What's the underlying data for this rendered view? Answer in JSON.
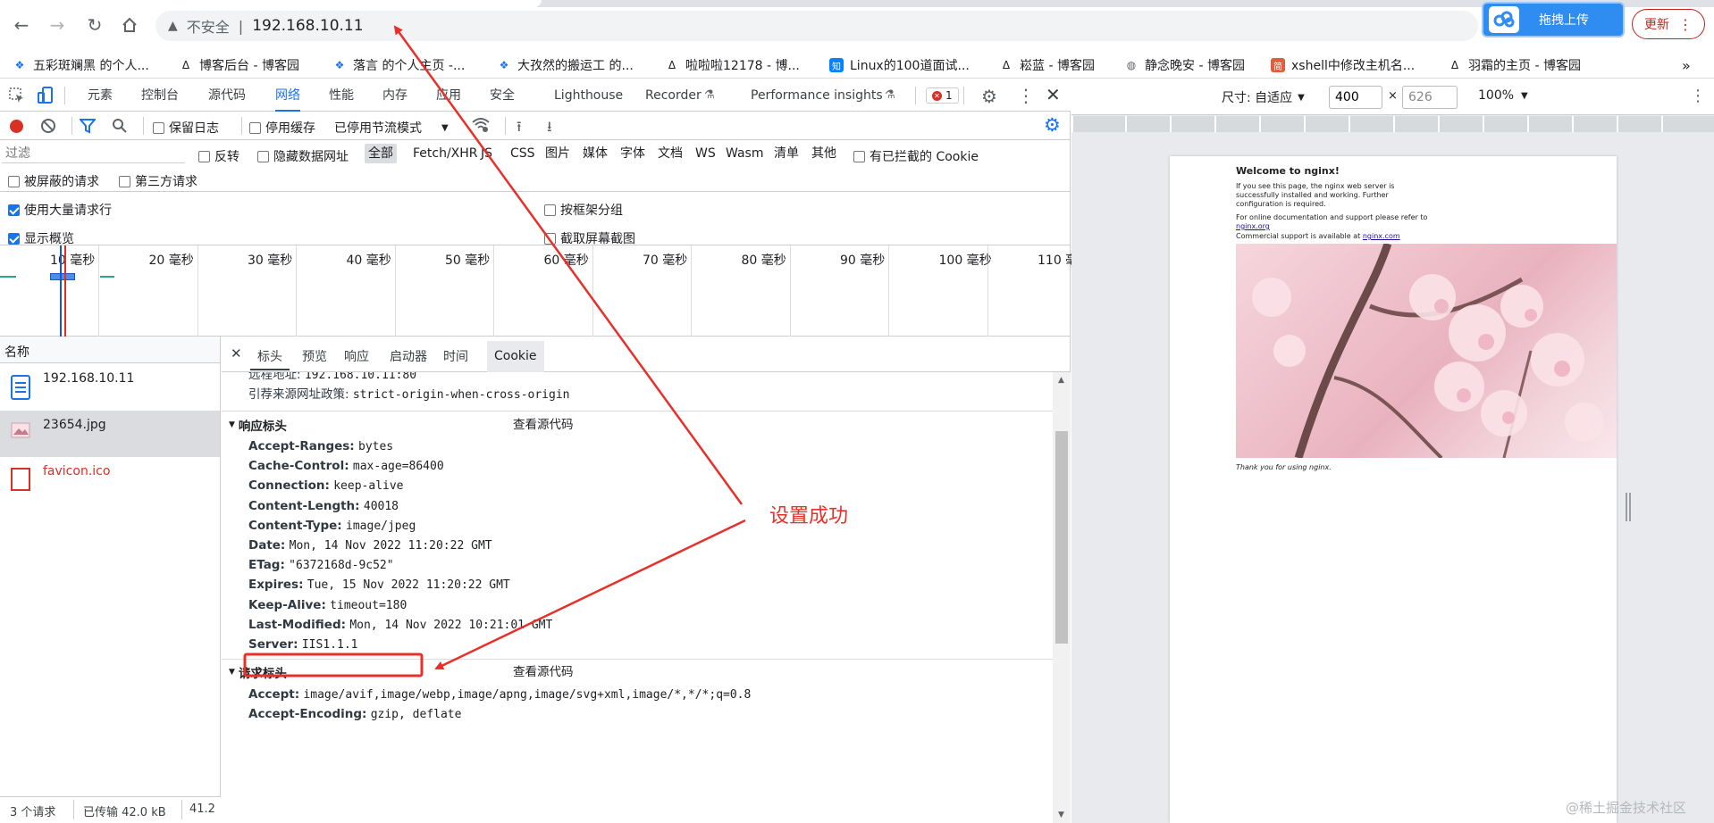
{
  "browser": {
    "address": {
      "security_label": "不安全",
      "url": "192.168.10.11"
    },
    "extension": {
      "upload_label": "拖拽上传"
    },
    "update_label": "更新"
  },
  "bookmarks": [
    {
      "label": "五彩斑斓黑 的个人...",
      "icon": "bookmark-icon"
    },
    {
      "label": "博客后台 - 博客园",
      "icon": "cnblogs-icon"
    },
    {
      "label": "落言 的个人主页 -...",
      "icon": "bookmark-icon"
    },
    {
      "label": "大孜然的搬运工 的...",
      "icon": "bookmark-icon"
    },
    {
      "label": "啦啦啦12178 - 博...",
      "icon": "cnblogs-icon"
    },
    {
      "label": "Linux的100道面试...",
      "icon": "zhihu-icon"
    },
    {
      "label": "崧蓝 - 博客园",
      "icon": "cnblogs-icon"
    },
    {
      "label": "静念晚安 - 博客园",
      "icon": "globe-icon"
    },
    {
      "label": "xshell中修改主机名...",
      "icon": "jian-icon"
    },
    {
      "label": "羽霜的主页 - 博客园",
      "icon": "cnblogs-icon"
    }
  ],
  "bookmarks_more": "»",
  "devtools": {
    "tabs": [
      "元素",
      "控制台",
      "源代码",
      "网络",
      "性能",
      "内存",
      "应用",
      "安全",
      "Lighthouse",
      "Recorder",
      "Performance insights"
    ],
    "selected_tab": "网络",
    "error_count": "1",
    "toolbar": {
      "preserve_log": "保留日志",
      "disable_cache": "停用缓存",
      "throttle": "已停用节流模式"
    },
    "filter": {
      "placeholder": "过滤",
      "invert": "反转",
      "hide_data_urls": "隐藏数据网址",
      "types": [
        "全部",
        "Fetch/XHR",
        "JS",
        "CSS",
        "图片",
        "媒体",
        "字体",
        "文档",
        "WS",
        "Wasm",
        "清单",
        "其他"
      ],
      "blocked_cookies": "有已拦截的 Cookie",
      "blocked_requests": "被屏蔽的请求",
      "third_party": "第三方请求"
    },
    "options": {
      "big_rows": "使用大量请求行",
      "group_by_frame": "按框架分组",
      "show_overview": "显示概览",
      "capture_screenshots": "截取屏幕截图"
    },
    "timeline_ticks": [
      "10 毫秒",
      "20 毫秒",
      "30 毫秒",
      "40 毫秒",
      "50 毫秒",
      "60 毫秒",
      "70 毫秒",
      "80 毫秒",
      "90 毫秒",
      "100 毫秒",
      "110 毫秒"
    ],
    "requests_header": "名称",
    "requests": [
      {
        "name": "192.168.10.11",
        "icon": "document-icon"
      },
      {
        "name": "23654.jpg",
        "icon": "image-icon"
      },
      {
        "name": "favicon.ico",
        "icon": "error-file-icon"
      }
    ],
    "status": {
      "requests": "3 个请求",
      "transferred": "已传输 42.0 kB",
      "size": "41.2"
    },
    "detail_tabs": [
      "标头",
      "预览",
      "响应",
      "启动器",
      "时间",
      "Cookie"
    ],
    "general": [
      {
        "name": "远程地址:",
        "value": "192.168.10.11:80"
      },
      {
        "name": "引荐来源网址政策:",
        "value": "strict-origin-when-cross-origin"
      }
    ],
    "response_section": {
      "title": "响应标头",
      "view_source": "查看源代码"
    },
    "response_headers": [
      {
        "name": "Accept-Ranges:",
        "value": "bytes"
      },
      {
        "name": "Cache-Control:",
        "value": "max-age=86400"
      },
      {
        "name": "Connection:",
        "value": "keep-alive"
      },
      {
        "name": "Content-Length:",
        "value": "40018"
      },
      {
        "name": "Content-Type:",
        "value": "image/jpeg"
      },
      {
        "name": "Date:",
        "value": "Mon, 14 Nov 2022 11:20:22 GMT"
      },
      {
        "name": "ETag:",
        "value": "\"6372168d-9c52\""
      },
      {
        "name": "Expires:",
        "value": "Tue, 15 Nov 2022 11:20:22 GMT"
      },
      {
        "name": "Keep-Alive:",
        "value": "timeout=180"
      },
      {
        "name": "Last-Modified:",
        "value": "Mon, 14 Nov 2022 10:21:01 GMT"
      },
      {
        "name": "Server:",
        "value": "IIS1.1.1"
      }
    ],
    "request_section": {
      "title": "请求标头",
      "view_source": "查看源代码"
    },
    "request_headers": [
      {
        "name": "Accept:",
        "value": "image/avif,image/webp,image/apng,image/svg+xml,image/*,*/*;q=0.8"
      },
      {
        "name": "Accept-Encoding:",
        "value": "gzip, deflate"
      }
    ]
  },
  "device": {
    "size_label": "尺寸: 自适应",
    "width": "400",
    "height": "626",
    "zoom": "100%"
  },
  "nginx_page": {
    "title": "Welcome to nginx!",
    "p1": "If you see this page, the nginx web server is successfully installed and working. Further configuration is required.",
    "p2a": "For online documentation and support please refer to",
    "link1": "nginx.org",
    "p3a": "Commercial support is available at",
    "link2": "nginx.com",
    "thanks": "Thank you for using nginx."
  },
  "annotation": {
    "text": "设置成功",
    "color": "#e8302a"
  },
  "watermark": "@稀土掘金技术社区"
}
